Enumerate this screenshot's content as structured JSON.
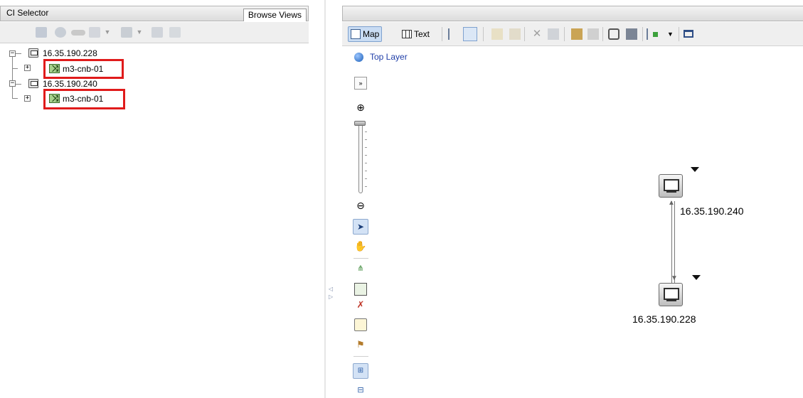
{
  "left_panel": {
    "title": "CI Selector",
    "browse_tab": "Browse Views",
    "toolbar_icons": [
      "pin-icon",
      "database-icon",
      "link-icon",
      "new-item-icon",
      "save-icon",
      "export-icon",
      "copy-icon"
    ]
  },
  "tree": {
    "nodes": [
      {
        "label": "16.35.190.228",
        "expander": "−",
        "icon": "host-icon",
        "child": {
          "label": "m3-cnb-01",
          "expander": "+",
          "icon": "network-node-icon"
        }
      },
      {
        "label": "16.35.190.240",
        "expander": "−",
        "icon": "host-icon",
        "child": {
          "label": "m3-cnb-01",
          "expander": "+",
          "icon": "network-node-icon"
        }
      }
    ],
    "highlight_color": "#e01b1b"
  },
  "right_panel": {
    "map_label": "Map",
    "text_label": "Text",
    "breadcrumb": "Top Layer",
    "map_nodes": [
      {
        "label": "16.35.190.240",
        "icon": "host-icon"
      },
      {
        "label": "16.35.190.228",
        "icon": "host-icon"
      }
    ],
    "accent_color": "#c9dcf3",
    "link_color": "#1f3ea8"
  }
}
